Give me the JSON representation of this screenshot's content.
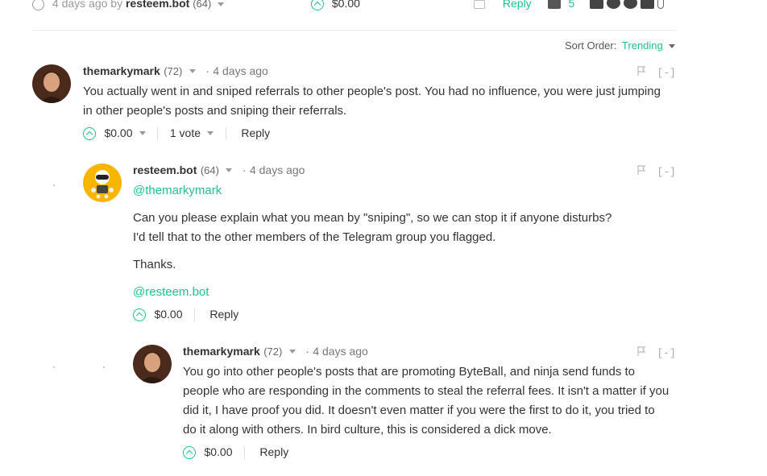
{
  "top_bar": {
    "meta": "4 days ago by",
    "author": "resteem.bot",
    "rep": "(64)",
    "payout": "$0.00",
    "reply": "Reply",
    "comments_count": "5"
  },
  "sort": {
    "label": "Sort Order:",
    "value": "Trending"
  },
  "comments": [
    {
      "author": "themarkymark",
      "rep": "(72)",
      "time": "4 days ago",
      "collapse": "[-]",
      "body": [
        "You actually went in and sniped referrals to other people's post. You had no influence, you were just jumping",
        "in other people's posts and sniping their referrals."
      ],
      "payout": "$0.00",
      "votes": "1 vote",
      "reply": "Reply"
    },
    {
      "author": "resteem.bot",
      "rep": "(64)",
      "time": "4 days ago",
      "collapse": "[-]",
      "mention": "@themarkymark",
      "body": [
        "Can you please explain what you mean by \"sniping\", so we can stop it if anyone disturbs?",
        "I'd tell that to the other members of the Telegram group you flagged."
      ],
      "thanks": "Thanks.",
      "signature": "@resteem.bot",
      "payout": "$0.00",
      "reply": "Reply"
    },
    {
      "author": "themarkymark",
      "rep": "(72)",
      "time": "4 days ago",
      "collapse": "[-]",
      "body": [
        "You go into other people's posts that are promoting ByteBall, and ninja send funds to",
        "people who are responding in the comments to steal the referral fees. It isn't a matter if you",
        "did it, I have proof you did. It doesn't even matter if you were the first to do it, you tried to",
        "do it along with others. In bird culture, this is considered a dick move."
      ],
      "payout": "$0.00",
      "reply": "Reply"
    }
  ],
  "colors": {
    "accent": "#1fbf8f",
    "text": "#333333",
    "muted": "#999999"
  }
}
